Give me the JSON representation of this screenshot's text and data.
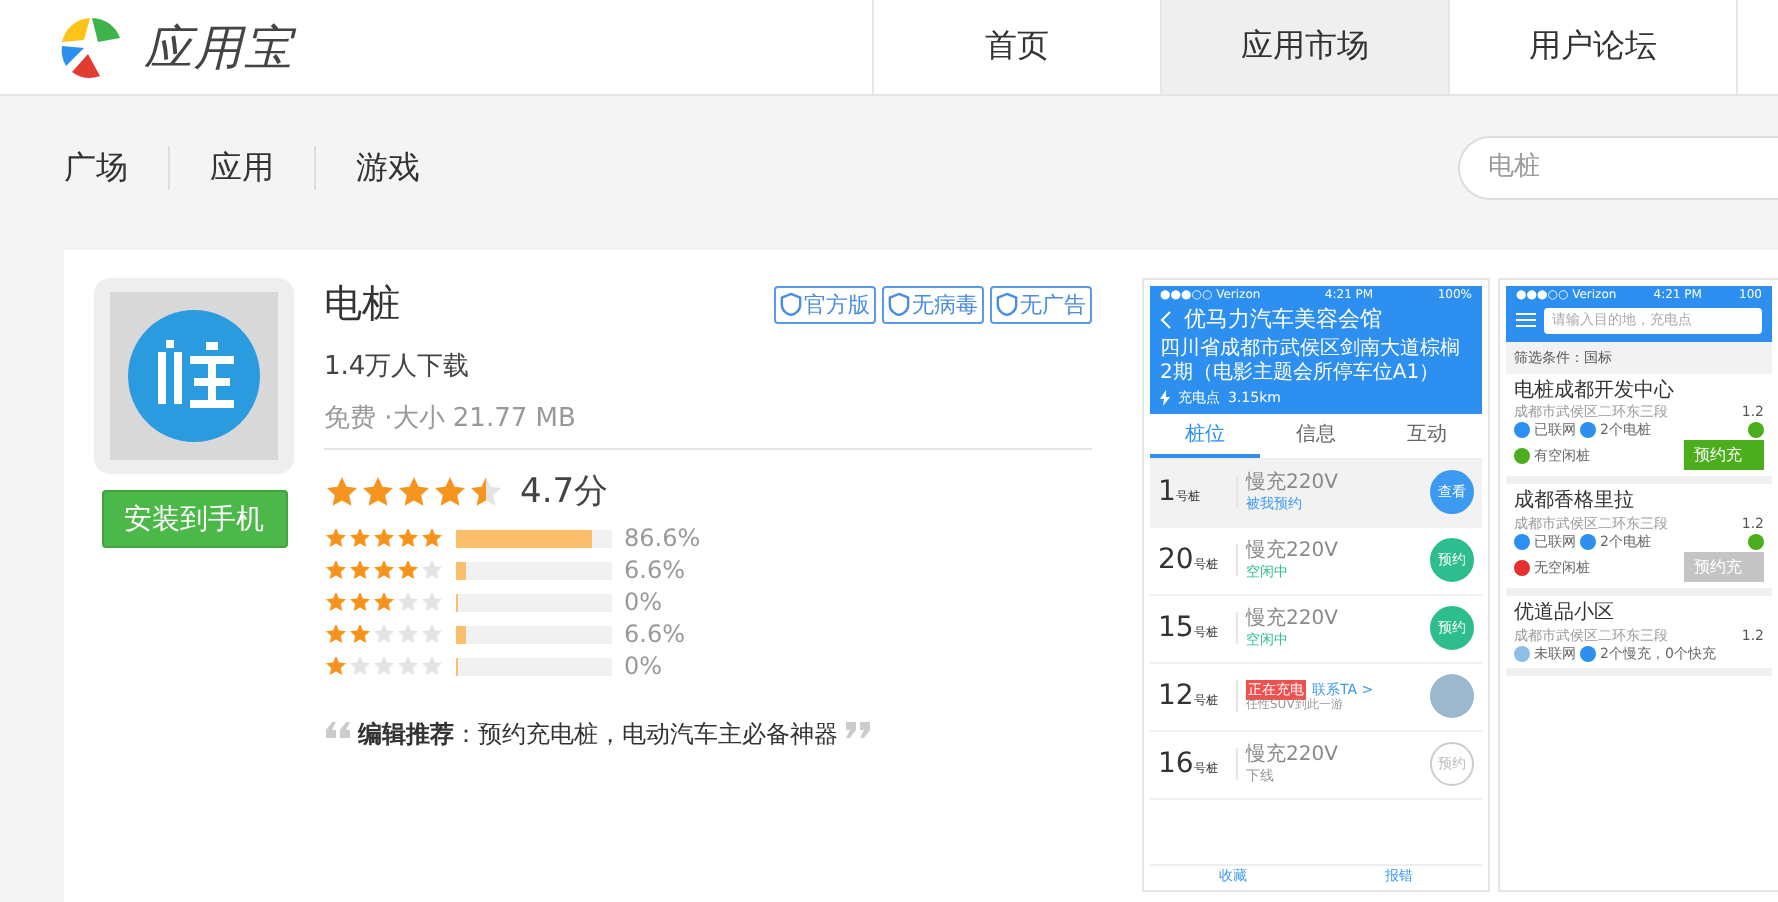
{
  "header": {
    "logo_text": "应用宝",
    "nav": [
      {
        "label": "首页",
        "selected": false
      },
      {
        "label": "应用市场",
        "selected": true
      },
      {
        "label": "用户论坛",
        "selected": false
      }
    ]
  },
  "subnav": {
    "items": [
      {
        "label": "广场"
      },
      {
        "label": "应用"
      },
      {
        "label": "游戏"
      }
    ],
    "search": {
      "placeholder": "电桩"
    }
  },
  "app": {
    "name": "电桩",
    "badges": [
      "官方版",
      "无病毒",
      "无广告"
    ],
    "downloads": "1.4万人下载",
    "meta": "免费 ·大小 21.77 MB",
    "install_button": "安装到手机",
    "rating": {
      "stars": 4.5,
      "score": "4.7分"
    },
    "distribution": [
      {
        "stars": 5,
        "level": 0.866,
        "percent": "86.6%"
      },
      {
        "stars": 4,
        "level": 0.066,
        "percent": "6.6%"
      },
      {
        "stars": 3,
        "level": 0,
        "percent": "0%"
      },
      {
        "stars": 2,
        "level": 0.066,
        "percent": "6.6%"
      },
      {
        "stars": 1,
        "level": 0,
        "percent": "0%"
      }
    ],
    "editor_pick": {
      "label": "编辑推荐",
      "text": "：预约充电桩，电动汽车主必备神器"
    }
  },
  "screenshots": [
    {
      "kind": "station_detail",
      "status": {
        "carrier": "●●●○○ Verizon",
        "time": "4:21 PM",
        "battery": "100%"
      },
      "title": "优马力汽车美容会馆",
      "address": "四川省成都市武侯区剑南大道棕榈2期（电影主题会所停车位A1）",
      "distance_label": "充电点",
      "distance": "3.15km",
      "tabs": [
        {
          "label": "桩位",
          "selected": true
        },
        {
          "label": "信息",
          "selected": false
        },
        {
          "label": "互动",
          "selected": false
        }
      ],
      "piles": [
        {
          "kind": "mine",
          "number": "1",
          "unit": "号桩",
          "type": "慢充220V",
          "status": "被我预约",
          "action": "查看"
        },
        {
          "kind": "free",
          "number": "20",
          "unit": "号桩",
          "type": "慢充220V",
          "status": "空闲中",
          "action": "预约"
        },
        {
          "kind": "free",
          "number": "15",
          "unit": "号桩",
          "type": "慢充220V",
          "status": "空闲中",
          "action": "预约"
        },
        {
          "kind": "charging",
          "number": "12",
          "unit": "号桩",
          "tag": "正在充电",
          "link": "联系TA >",
          "note": "任性SUV到此一游"
        },
        {
          "kind": "offline",
          "number": "16",
          "unit": "号桩",
          "type": "慢充220V",
          "status": "下线",
          "action": "预约"
        }
      ],
      "bottom_bar": [
        "收藏",
        "报错"
      ]
    },
    {
      "kind": "station_list",
      "status": {
        "carrier": "●●●○○ Verizon",
        "time": "4:21 PM",
        "battery": "100"
      },
      "search_placeholder": "请输入目的地，充电点",
      "filter": "筛选条件：国标",
      "stations": [
        {
          "name": "电桩成都开发中心",
          "address": "成都市武侯区二环东三段",
          "distance": "1.2",
          "network": "已联网",
          "online": true,
          "piles": "2个电桩",
          "availability": "有空闲桩",
          "available": true,
          "button": "预约充"
        },
        {
          "name": "成都香格里拉",
          "address": "成都市武侯区二环东三段",
          "distance": "1.2",
          "network": "已联网",
          "online": true,
          "piles": "2个电桩",
          "availability": "无空闲桩",
          "available": false,
          "button": "预约充"
        },
        {
          "name": "优道品小区",
          "address": "成都市武侯区二环东三段",
          "distance": "1.2",
          "network": "未联网",
          "online": false,
          "piles": "2个慢充，0个快充"
        }
      ]
    }
  ]
}
